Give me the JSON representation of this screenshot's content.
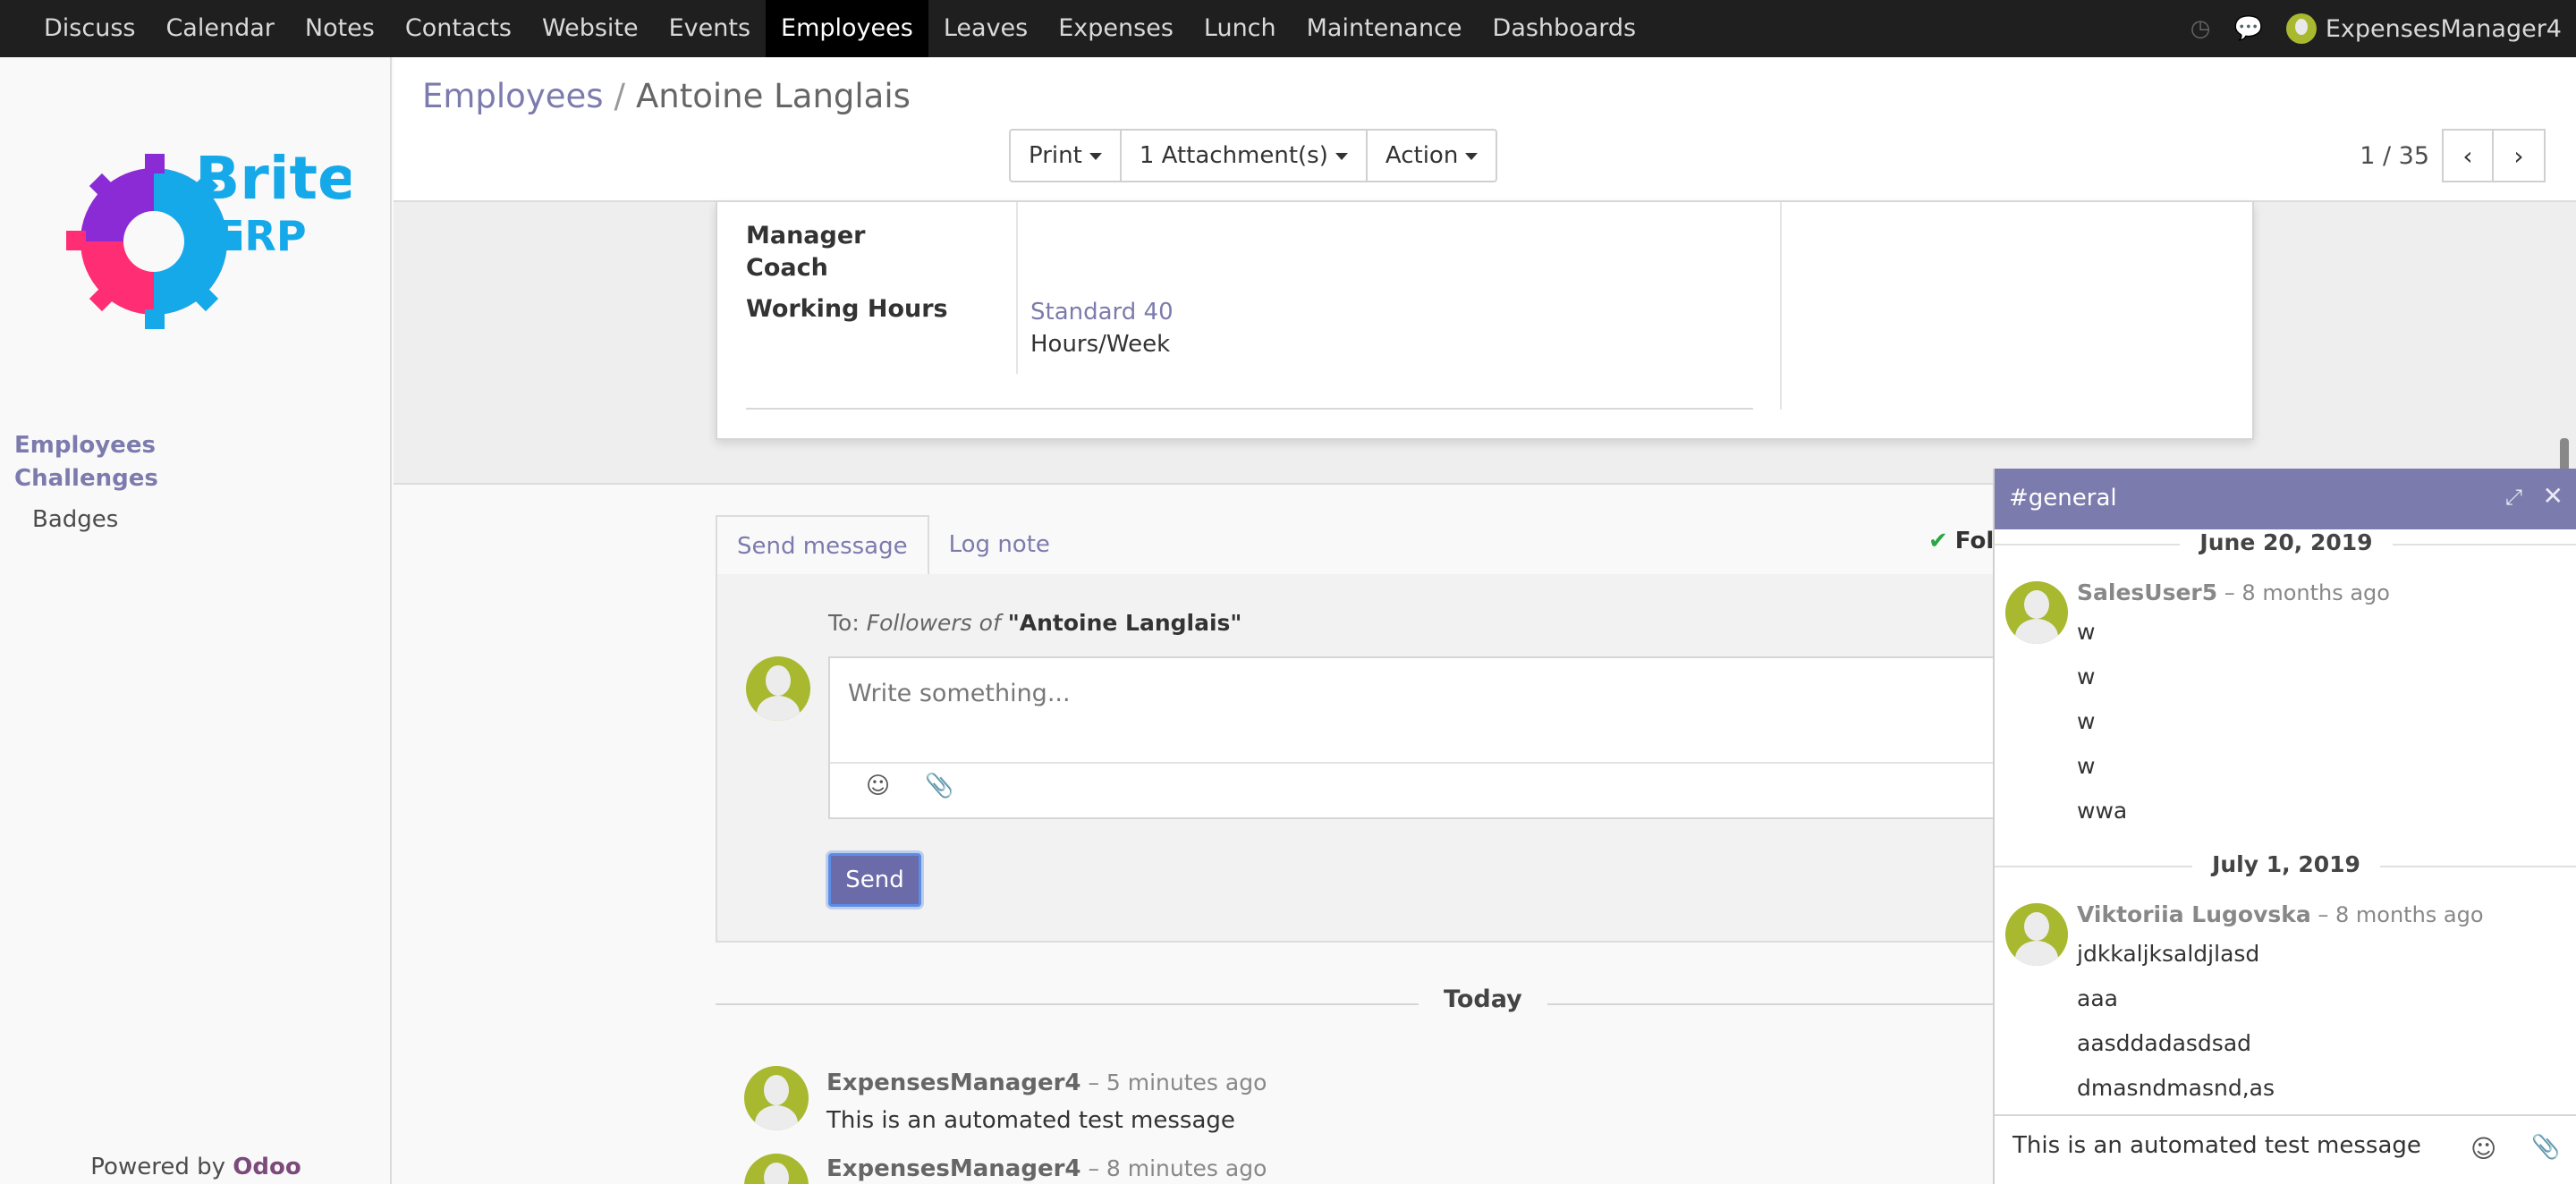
{
  "topnav": {
    "items": [
      "Discuss",
      "Calendar",
      "Notes",
      "Contacts",
      "Website",
      "Events",
      "Employees",
      "Leaves",
      "Expenses",
      "Lunch",
      "Maintenance",
      "Dashboards"
    ],
    "active_index": 6,
    "user_name": "ExpensesManager4",
    "clock_icon": "◷",
    "chat_icon": "💬"
  },
  "logo": {
    "text1": "Brite",
    "text2": "ERP"
  },
  "sidebar": {
    "items": [
      {
        "label": "Employees"
      },
      {
        "label": "Challenges"
      },
      {
        "label": "Badges"
      }
    ],
    "powered_prefix": "Powered by ",
    "powered_brand": "Odoo"
  },
  "breadcrumb": {
    "parent": "Employees",
    "separator": "/",
    "current": "Antoine Langlais"
  },
  "toolbar": {
    "print": "Print",
    "attachments": "1 Attachment(s)",
    "action": "Action"
  },
  "pager": {
    "value": "1 / 35",
    "prev": "‹",
    "next": "›"
  },
  "form": {
    "manager_label": "Manager",
    "coach_label": "Coach",
    "working_hours_label": "Working Hours",
    "working_hours_value": "Standard 40",
    "working_hours_unit": "Hours/Week"
  },
  "chatter": {
    "tab_send": "Send message",
    "tab_log": "Log note",
    "follow_check": "✔",
    "follow_label": "Foll",
    "to_prefix": "To: ",
    "to_italic": "Followers of",
    "to_record": "\"Antoine Langlais\"",
    "placeholder": "Write something...",
    "emoji_icon": "☺",
    "attach_icon": "📎",
    "send_label": "Send",
    "today_label": "Today",
    "messages": [
      {
        "author": "ExpensesManager4",
        "when": " – 5 minutes ago",
        "body": "This is an automated test message"
      },
      {
        "author": "ExpensesManager4",
        "when": " – 8 minutes ago",
        "body": ""
      }
    ]
  },
  "chat_window": {
    "title": "#general",
    "expand_icon": "⤢",
    "close_icon": "✕",
    "day1": "June 20, 2019",
    "msg1_author": "SalesUser5",
    "msg1_when": " – 8 months ago",
    "msg1_lines": [
      "w",
      "w",
      "w",
      "w",
      "wwa"
    ],
    "day2": "July 1, 2019",
    "msg2_author": "Viktoriia Lugovska",
    "msg2_when": " – 8 months ago",
    "msg2_lines": [
      "jdkkaljksaldjlasd",
      "aaa",
      "aasddadasdsad",
      "dmasndmasnd,as"
    ],
    "input_value": "This is an automated test message",
    "emoji_icon": "☺",
    "attach_icon": "📎"
  }
}
